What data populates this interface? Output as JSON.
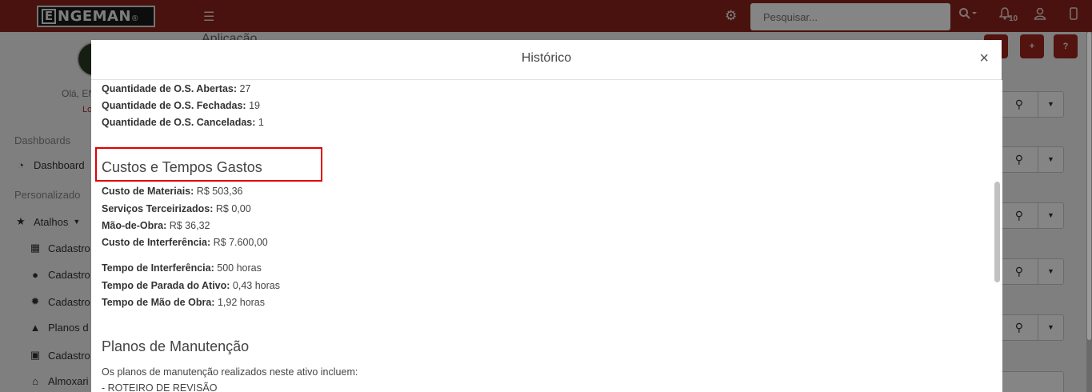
{
  "topbar": {
    "logo_letter": "E",
    "logo_text": "NGEMAN",
    "logo_reg": "®",
    "menu_icon": "hamburger-icon",
    "search_placeholder": "Pesquisar...",
    "notification_count": "10",
    "icons": [
      "gear-icon",
      "search-dropdown-icon",
      "bell-icon",
      "user-icon",
      "mobile-icon"
    ]
  },
  "sidebar": {
    "greeting": "Olá, EN",
    "logout": "Lo",
    "section_dashboards": "Dashboards",
    "dashboard_item": "Dashboard",
    "section_personalizado": "Personalizado",
    "atalhos": "Atalhos",
    "items": [
      {
        "icon": "building-icon",
        "label": "Cadastro"
      },
      {
        "icon": "user-icon",
        "label": "Cadastro"
      },
      {
        "icon": "cog-icon",
        "label": "Cadastro"
      },
      {
        "icon": "hard-hat-icon",
        "label": "Planos d"
      },
      {
        "icon": "id-card-icon",
        "label": "Cadastro"
      },
      {
        "icon": "warehouse-icon",
        "label": "Almoxari"
      }
    ]
  },
  "background_page": {
    "title": "Aplicação"
  },
  "modal": {
    "title": "Histórico",
    "close_label": "×",
    "os_stats": [
      {
        "label": "Quantidade de O.S. Abertas:",
        "value": "27"
      },
      {
        "label": "Quantidade de O.S. Fechadas:",
        "value": "19"
      },
      {
        "label": "Quantidade de O.S. Canceladas:",
        "value": "1"
      }
    ],
    "costs_title": "Custos e Tempos Gastos",
    "costs": [
      {
        "label": "Custo de Materiais:",
        "value": "R$ 503,36"
      },
      {
        "label": "Serviços Terceirizados:",
        "value": "R$ 0,00"
      },
      {
        "label": "Mão-de-Obra:",
        "value": "R$ 36,32"
      },
      {
        "label": "Custo de Interferência:",
        "value": "R$ 7.600,00"
      }
    ],
    "times": [
      {
        "label": "Tempo de Interferência:",
        "value": "500 horas"
      },
      {
        "label": "Tempo de Parada do Ativo:",
        "value": "0,43 horas"
      },
      {
        "label": "Tempo de Mão de Obra:",
        "value": "1,92 horas"
      }
    ],
    "plans_title": "Planos de Manutenção",
    "plans_intro": "Os planos de manutenção realizados neste ativo incluem:",
    "plans_first": "- ROTEIRO DE REVISÃO"
  },
  "colors": {
    "topbar": "#8d241c",
    "highlight_border": "#e00000"
  }
}
